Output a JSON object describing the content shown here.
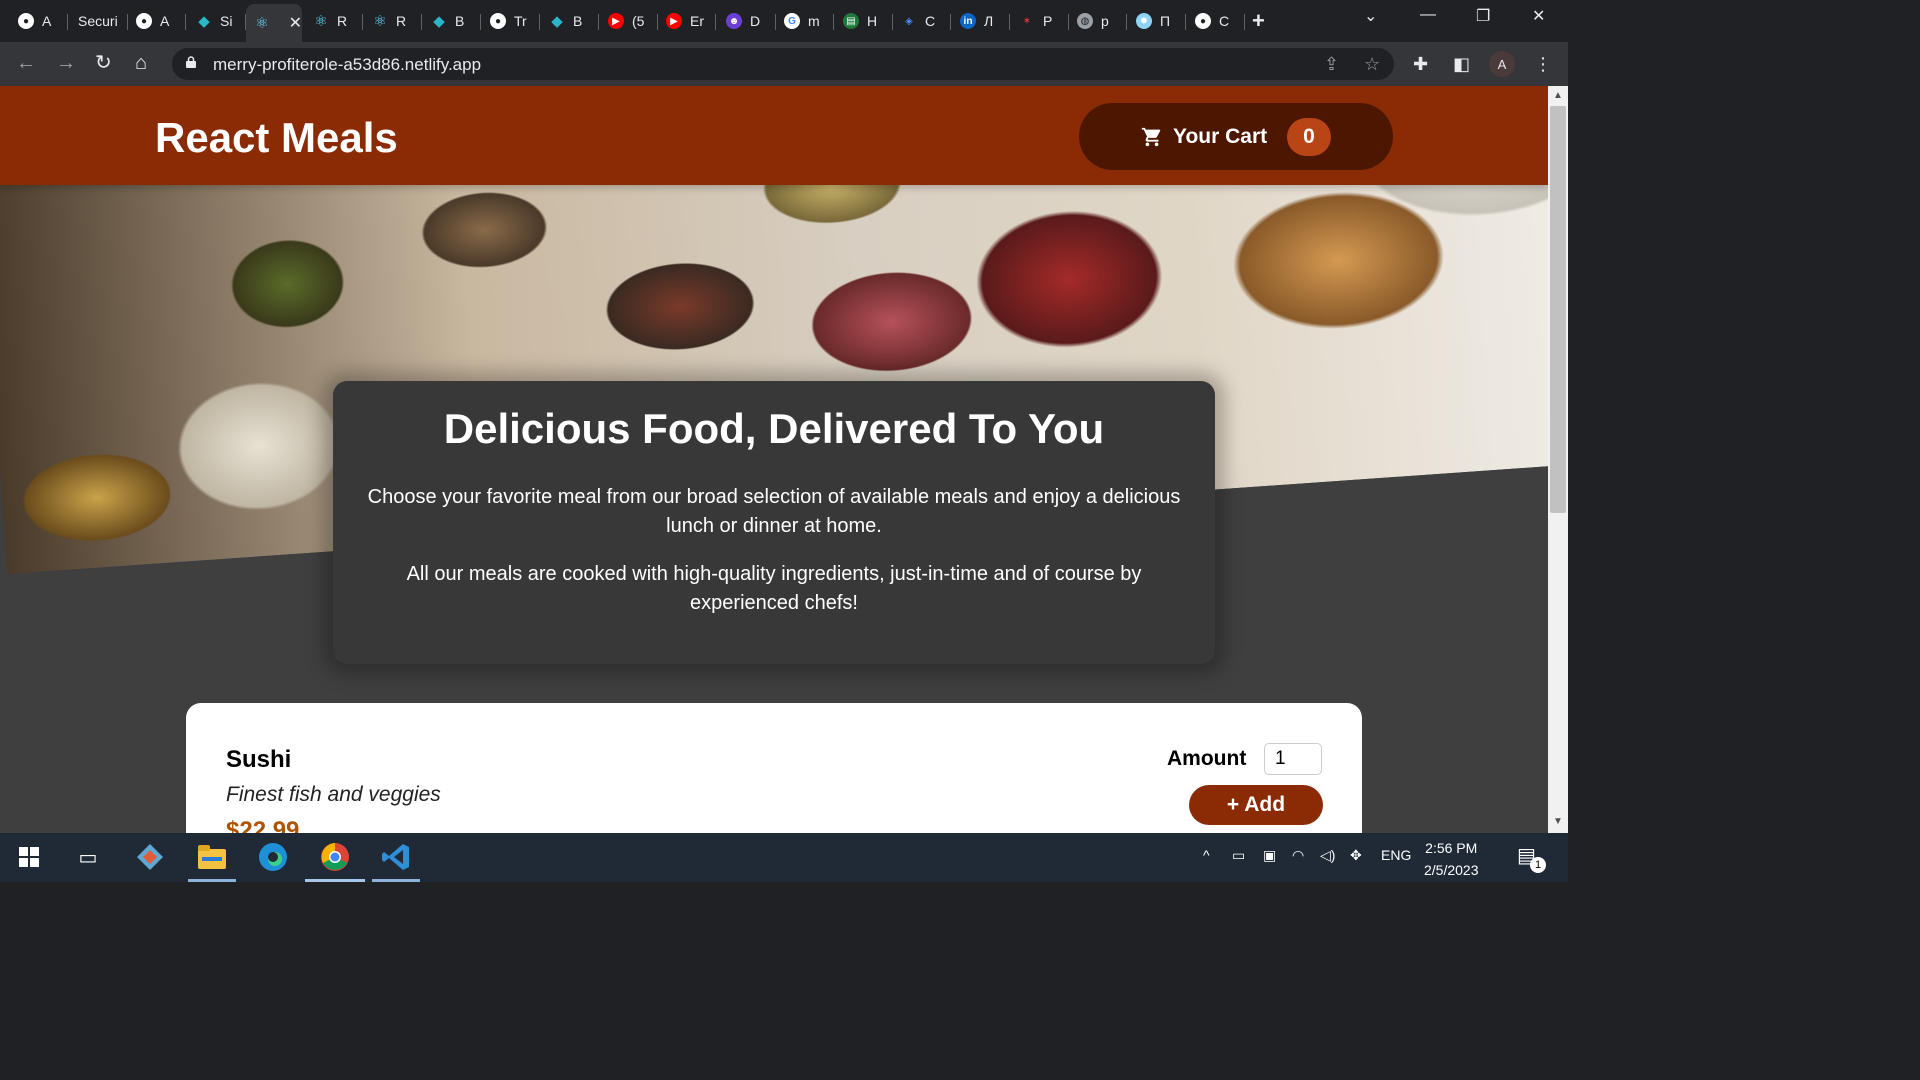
{
  "browser": {
    "tabs": [
      {
        "icon": "github-icon",
        "label": "A"
      },
      {
        "icon": "none",
        "label": "Securi"
      },
      {
        "icon": "github-icon",
        "label": "A"
      },
      {
        "icon": "diamond-icon",
        "label": "Si"
      },
      {
        "icon": "react-icon",
        "label": "",
        "active": true
      },
      {
        "icon": "react-icon",
        "label": "R"
      },
      {
        "icon": "react-icon",
        "label": "R"
      },
      {
        "icon": "diamond-icon",
        "label": "B"
      },
      {
        "icon": "github-icon",
        "label": "Tr"
      },
      {
        "icon": "diamond-icon",
        "label": "B"
      },
      {
        "icon": "youtube-icon",
        "label": "(5"
      },
      {
        "icon": "youtube-icon",
        "label": "Er"
      },
      {
        "icon": "face-icon",
        "label": "D"
      },
      {
        "icon": "google-icon",
        "label": "m"
      },
      {
        "icon": "meals-icon",
        "label": "H"
      },
      {
        "icon": "codepen-icon",
        "label": "C"
      },
      {
        "icon": "linkedin-icon",
        "label": "Л"
      },
      {
        "icon": "figure-icon",
        "label": "P"
      },
      {
        "icon": "globe-icon",
        "label": "p"
      },
      {
        "icon": "gear-square-icon",
        "label": "П"
      },
      {
        "icon": "github-icon",
        "label": "C"
      }
    ],
    "url": "merry-profiterole-a53d86.netlify.app",
    "profile_initial": "A"
  },
  "app": {
    "brand": "React Meals",
    "cart": {
      "label": "Your Cart",
      "count": "0"
    },
    "summary": {
      "title": "Delicious Food, Delivered To You",
      "p1": "Choose your favorite meal from our broad selection of available meals and enjoy a delicious lunch or dinner at home.",
      "p2": "All our meals are cooked with high-quality ingredients, just-in-time and of course by experienced chefs!"
    },
    "meals": [
      {
        "name": "Sushi",
        "description": "Finest fish and veggies",
        "price": "$22.99",
        "amount_label": "Amount",
        "amount_value": "1",
        "add_label": "+ Add"
      }
    ]
  },
  "taskbar": {
    "language": "ENG",
    "time": "2:56 PM",
    "date": "2/5/2023",
    "notifications": "1"
  },
  "colors": {
    "header": "#8a2b06",
    "cart_button": "#4d1601",
    "cart_badge": "#b94517",
    "summary_bg": "#383838",
    "page_bg": "#3f3f3f",
    "price": "#ad5502"
  }
}
